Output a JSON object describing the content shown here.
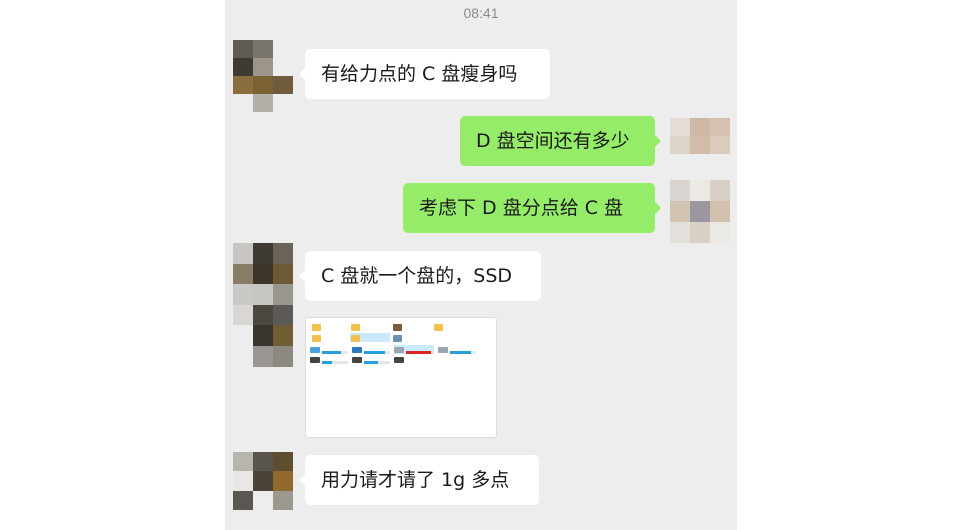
{
  "chat": {
    "timestamp": "08:41",
    "messages": [
      {
        "side": "in",
        "text": "有给力点的 C 盘瘦身吗"
      },
      {
        "side": "out",
        "text": "D 盘空间还有多少"
      },
      {
        "side": "out",
        "text": "考虑下 D 盘分点给 C 盘"
      },
      {
        "side": "in",
        "text": "C 盘就一个盘的，SSD"
      },
      {
        "side": "in",
        "type": "image",
        "drives_usage": [
          0.72,
          0.8,
          0.95,
          0.82
        ]
      },
      {
        "side": "in",
        "text": "用力请才请了 1g 多点"
      }
    ]
  },
  "colors": {
    "chat_bg": "#ededed",
    "outgoing_bubble": "#95ec69",
    "incoming_bubble": "#ffffff",
    "drive_bar": "#26a0da",
    "drive_bar_full": "#da2626"
  }
}
